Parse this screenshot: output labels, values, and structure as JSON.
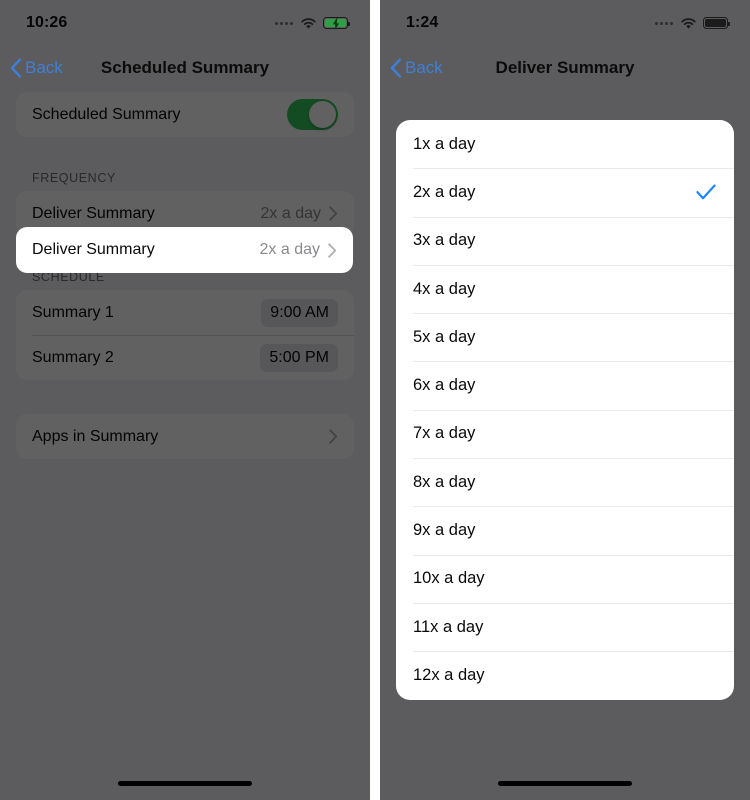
{
  "colors": {
    "accent_blue": "#3f7fd8",
    "toggle_green": "#34c759",
    "check_blue": "#1a86ff",
    "scrim": "rgba(0,0,0,0.62)",
    "card_white": "#ffffff"
  },
  "left_phone": {
    "status_bar": {
      "time": "10:26",
      "cellular_icon": "cellular-dots-icon",
      "wifi_icon": "wifi-icon",
      "battery_icon": "battery-charging-icon",
      "battery_state": "charging"
    },
    "nav": {
      "back_label": "Back",
      "back_icon": "chevron-left-icon",
      "title": "Scheduled Summary"
    },
    "toggle_row": {
      "label": "Scheduled Summary",
      "toggle_state": "on"
    },
    "frequency": {
      "header": "FREQUENCY",
      "row": {
        "label": "Deliver Summary",
        "value": "2x a day",
        "chevron_icon": "chevron-right-icon"
      }
    },
    "schedule": {
      "header": "SCHEDULE",
      "rows": [
        {
          "label": "Summary 1",
          "value": "9:00 AM"
        },
        {
          "label": "Summary 2",
          "value": "5:00 PM"
        }
      ]
    },
    "apps_row": {
      "label": "Apps in Summary",
      "chevron_icon": "chevron-right-icon"
    }
  },
  "right_phone": {
    "status_bar": {
      "time": "1:24",
      "cellular_icon": "cellular-dots-icon",
      "wifi_icon": "wifi-icon",
      "battery_icon": "battery-full-icon",
      "battery_state": "full"
    },
    "nav": {
      "back_label": "Back",
      "back_icon": "chevron-left-icon",
      "title": "Deliver Summary"
    },
    "picker": {
      "selected": "2x a day",
      "check_icon": "checkmark-icon",
      "options": [
        {
          "label": "1x a day",
          "selected": false
        },
        {
          "label": "2x a day",
          "selected": true
        },
        {
          "label": "3x a day",
          "selected": false
        },
        {
          "label": "4x a day",
          "selected": false
        },
        {
          "label": "5x a day",
          "selected": false
        },
        {
          "label": "6x a day",
          "selected": false
        },
        {
          "label": "7x a day",
          "selected": false
        },
        {
          "label": "8x a day",
          "selected": false
        },
        {
          "label": "9x a day",
          "selected": false
        },
        {
          "label": "10x a day",
          "selected": false
        },
        {
          "label": "11x a day",
          "selected": false
        },
        {
          "label": "12x a day",
          "selected": false
        }
      ]
    }
  }
}
